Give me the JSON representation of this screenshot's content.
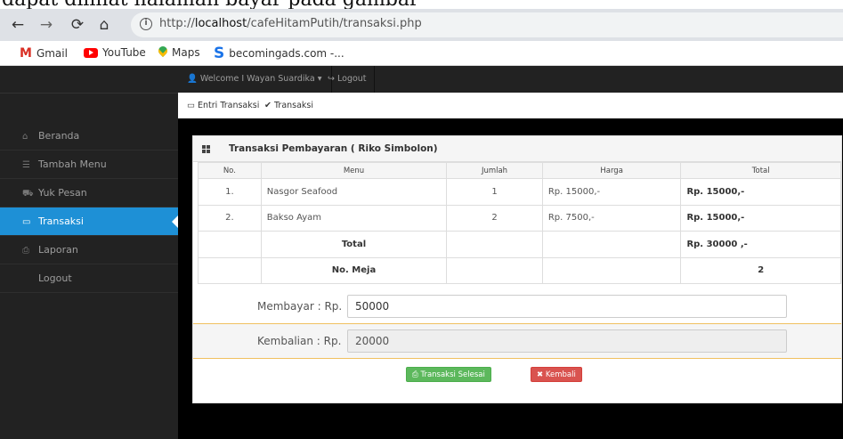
{
  "doc_top_text": "dapat dilihat halaman bayar pada gambar",
  "browser": {
    "url_prefix": "http://",
    "url_host": "localhost",
    "url_path": "/cafeHitamPutih/transaksi.php",
    "bookmarks": [
      {
        "label": "Gmail",
        "icon": "gmail-icon"
      },
      {
        "label": "YouTube",
        "icon": "youtube-icon"
      },
      {
        "label": "Maps",
        "icon": "maps-icon"
      },
      {
        "label": "becomingads.com -...",
        "icon": "s-logo-icon"
      }
    ]
  },
  "topnav": {
    "welcome": "Welcome I Wayan Suardika",
    "logout": "Logout"
  },
  "breadcrumb": {
    "item1": "Entri Transaksi",
    "item2": "Transaksi"
  },
  "sidebar": {
    "items": [
      {
        "label": "Beranda",
        "icon": "home-icon"
      },
      {
        "label": "Tambah Menu",
        "icon": "list-icon"
      },
      {
        "label": "Yuk Pesan",
        "icon": "cart-icon"
      },
      {
        "label": "Transaksi",
        "icon": "transaction-icon",
        "active": true
      },
      {
        "label": "Laporan",
        "icon": "print-icon"
      },
      {
        "label": "Logout",
        "icon": ""
      }
    ]
  },
  "panel": {
    "title": "Transaksi Pembayaran ( Riko Simbolon)",
    "headers": [
      "No.",
      "Menu",
      "Jumlah",
      "Harga",
      "Total"
    ],
    "rows": [
      {
        "no": "1.",
        "menu": "Nasgor Seafood",
        "jumlah": "1",
        "harga": "Rp. 15000,-",
        "total": "Rp. 15000,-"
      },
      {
        "no": "2.",
        "menu": "Bakso Ayam",
        "jumlah": "2",
        "harga": "Rp. 7500,-",
        "total": "Rp. 15000,-"
      }
    ],
    "total_label": "Total",
    "total_value": "Rp. 30000 ,-",
    "meja_label": "No. Meja",
    "meja_value": "2",
    "bayar_label": "Membayar : Rp.",
    "bayar_value": "50000",
    "kembali_label": "Kembalian : Rp.",
    "kembali_value": "20000",
    "btn_selesai": "Transaksi Selesai",
    "btn_kembali": "Kembali"
  },
  "colors": {
    "active": "#1e90d6",
    "success": "#5cb85c",
    "danger": "#d9534f"
  }
}
